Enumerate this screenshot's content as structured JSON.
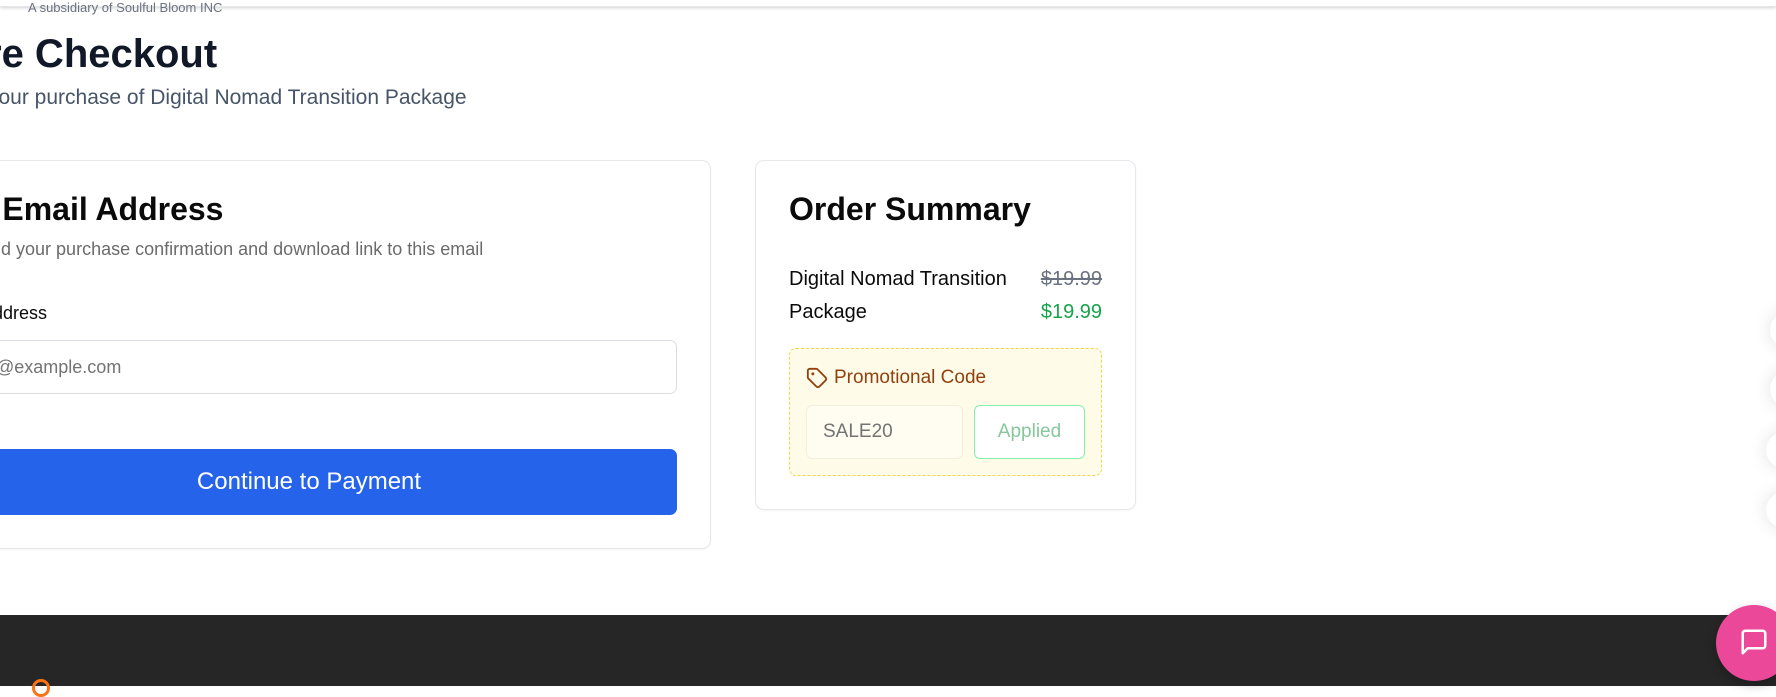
{
  "header": {
    "subsidiary_text": "A subsidiary of Soulful Bloom INC"
  },
  "page": {
    "title": "re Checkout",
    "subtitle": "your purchase of Digital Nomad Transition Package"
  },
  "email_section": {
    "heading": "r Email Address",
    "description": "end your purchase confirmation and download link to this email",
    "field_label": "Address",
    "field_placeholder": "@example.com",
    "field_value": "",
    "submit_label": "Continue to Payment"
  },
  "order_summary": {
    "heading": "Order Summary",
    "item_name": "Digital Nomad Transition Package",
    "original_price": "$19.99",
    "final_price": "$19.99",
    "promo": {
      "title": "Promotional Code",
      "icon": "tag-icon",
      "code_value": "SALE20",
      "status_label": "Applied"
    }
  },
  "widgets": {
    "chat_icon": "chat-bubble-icon"
  },
  "colors": {
    "primary": "#2563eb",
    "success": "#16a34a",
    "promo_bg": "#fefce8",
    "promo_text": "#92400e",
    "footer_bg": "#262626",
    "chat_button": "#ec4899"
  }
}
